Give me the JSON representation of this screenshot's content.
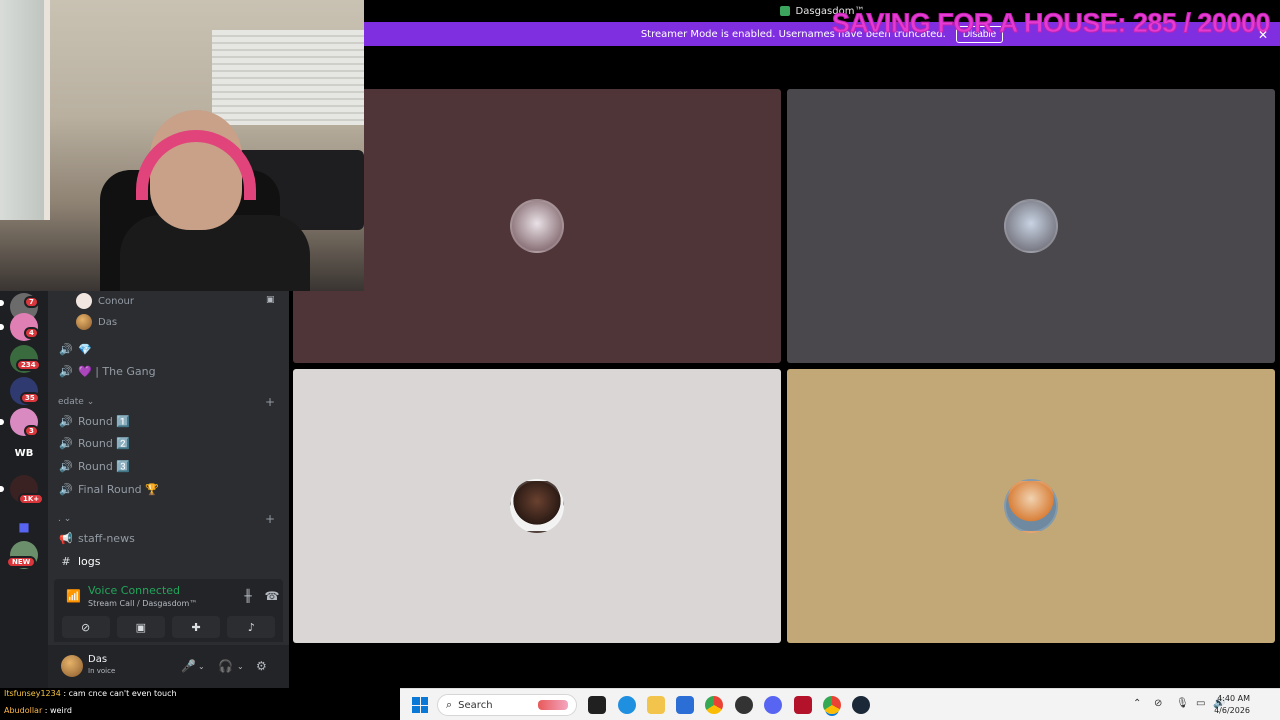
{
  "window": {
    "title": "Dasgasdom™"
  },
  "banner": {
    "text": "Streamer Mode is enabled. Usernames have been truncated.",
    "disable_label": "Disable"
  },
  "overlay": {
    "goal_text": "SAVING FOR A HOUSE: 285 / 20000",
    "goal_color": "#e53bd3"
  },
  "servers": [
    {
      "badge": "7"
    },
    {
      "badge": "4"
    },
    {
      "badge": "234"
    },
    {
      "badge": "35"
    },
    {
      "badge": "3"
    },
    {
      "label": "WB"
    },
    {
      "badge": "1K+"
    },
    {
      "badge": ""
    },
    {
      "badge": "NEW"
    }
  ],
  "channels": {
    "members": [
      "Conour",
      "Das"
    ],
    "voice_channels_top": [
      "💎",
      "💜 | The Gang"
    ],
    "category_edate": "edate",
    "rounds": [
      "Round 1️⃣",
      "Round 2️⃣",
      "Round 3️⃣",
      "Final Round 🏆"
    ],
    "category_dot": ".",
    "text_channels": [
      "staff-news",
      "logs"
    ]
  },
  "voice": {
    "status": "Voice Connected",
    "sub": "Stream Call / Dasgasdom™"
  },
  "user": {
    "name": "Das",
    "status": "In voice"
  },
  "chat": [
    {
      "user": "Itsfunsey1234",
      "message": "cam cnce can't even touch"
    },
    {
      "user": "Abudollar",
      "message": "weird"
    }
  ],
  "taskbar": {
    "search_placeholder": "Search",
    "time": "4:40 AM",
    "date": "4/6/2026"
  },
  "colors": {
    "banner_bg": "#7f2fe0",
    "voice_green": "#23a55a",
    "tile1": "#4f3538",
    "tile2": "#4b484d",
    "tile3": "#d9d6d5",
    "tile4": "#c2a876"
  }
}
